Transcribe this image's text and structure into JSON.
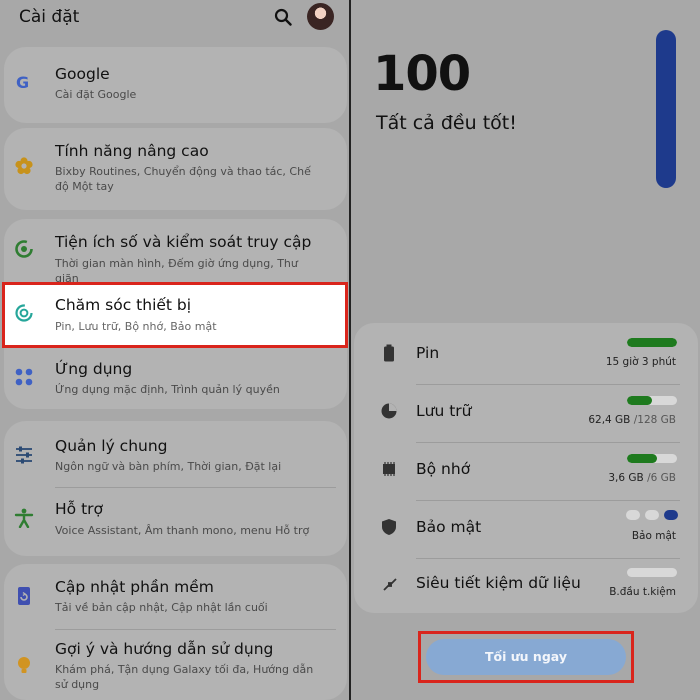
{
  "left": {
    "header": {
      "title": "Cài đặt"
    },
    "items": [
      {
        "title": "Google",
        "subtitle": "Cài đặt Google",
        "icon": "google-icon"
      },
      {
        "title": "Tính năng nâng cao",
        "subtitle": "Bixby Routines, Chuyển động và thao tác, Chế độ Một tay",
        "icon": "advanced-features-icon"
      },
      {
        "title": "Tiện ích số và kiểm soát truy cập",
        "subtitle": "Thời gian màn hình, Đếm giờ ứng dụng, Thư giãn",
        "icon": "digital-wellbeing-icon"
      },
      {
        "title": "Chăm sóc thiết bị",
        "subtitle": "Pin, Lưu trữ, Bộ nhớ, Bảo mật",
        "icon": "device-care-icon"
      },
      {
        "title": "Ứng dụng",
        "subtitle": "Ứng dụng mặc định, Trình quản lý quyền",
        "icon": "apps-icon"
      },
      {
        "title": "Quản lý chung",
        "subtitle": "Ngôn ngữ và bàn phím, Thời gian, Đặt lại",
        "icon": "general-management-icon"
      },
      {
        "title": "Hỗ trợ",
        "subtitle": "Voice Assistant, Âm thanh mono, menu Hỗ trợ",
        "icon": "accessibility-icon"
      },
      {
        "title": "Cập nhật phần mềm",
        "subtitle": "Tải về bản cập nhật, Cập nhật lần cuối",
        "icon": "software-update-icon"
      },
      {
        "title": "Gợi ý và hướng dẫn sử dụng",
        "subtitle": "Khám phá, Tận dụng Galaxy tối đa, Hướng dẫn sử dụng",
        "icon": "tips-icon"
      }
    ]
  },
  "right": {
    "score": "100",
    "status": "Tất cả đều tốt!",
    "rows": [
      {
        "label": "Pin",
        "value": "15 giờ 3 phút",
        "level": 1.0,
        "icon": "battery-icon"
      },
      {
        "label": "Lưu trữ",
        "value": "62,4 GB",
        "value_total": "/128 GB",
        "level": 0.49,
        "icon": "storage-icon"
      },
      {
        "label": "Bộ nhớ",
        "value": "3,6 GB",
        "value_total": "/6 GB",
        "level": 0.6,
        "icon": "memory-icon"
      },
      {
        "label": "Bảo mật",
        "value": "Bảo mật",
        "level": 1,
        "icon": "shield-icon"
      },
      {
        "label": "Siêu tiết kiệm dữ liệu",
        "value": "B.đầu t.kiệm",
        "level": 0,
        "icon": "data-saver-icon"
      }
    ],
    "optimize_button": "Tối ưu ngay"
  },
  "colors": {
    "accent_blue": "#1e3a8c",
    "progress_green": "#1e7a1e",
    "highlight_red": "#d9251c",
    "button_blue": "#87a9d3"
  }
}
